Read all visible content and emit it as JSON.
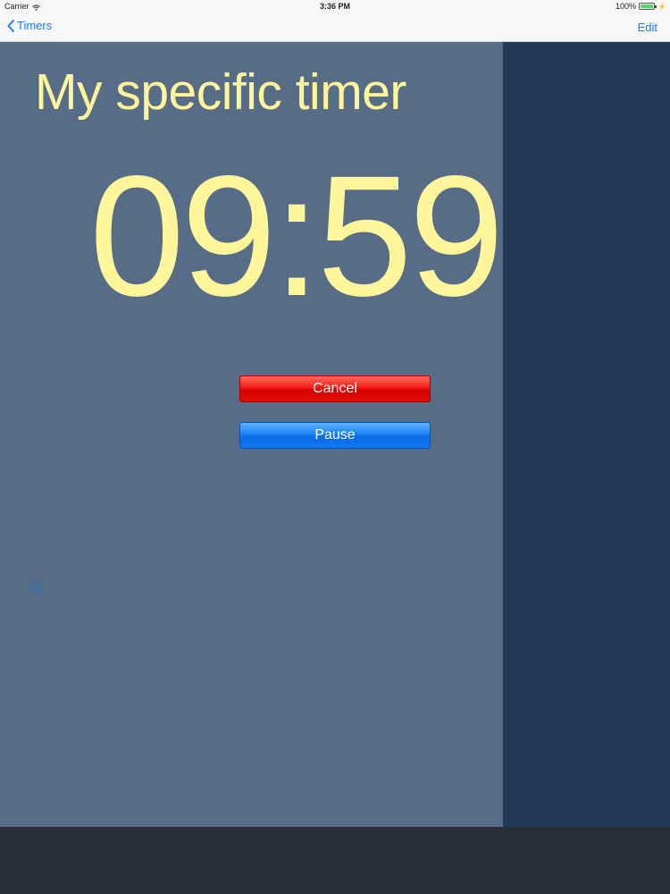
{
  "status_bar": {
    "carrier": "Carrier",
    "time": "3:36 PM",
    "battery_percent": "100%",
    "battery_level": 1.0
  },
  "nav_bar": {
    "back_label": "Timers",
    "edit_label": "Edit"
  },
  "timer": {
    "title": "My specific timer",
    "countdown": "09:59"
  },
  "buttons": {
    "cancel_label": "Cancel",
    "pause_label": "Pause"
  },
  "colors": {
    "accent_blue": "#1a7ff5",
    "timer_text": "#fff59a",
    "main_panel": "#576c86",
    "side_panel": "#233a57",
    "cancel_red": "#e0100a",
    "pause_blue": "#1076ef"
  },
  "icons": {
    "back": "chevron-left-icon",
    "wifi": "wifi-icon",
    "battery": "battery-icon"
  }
}
